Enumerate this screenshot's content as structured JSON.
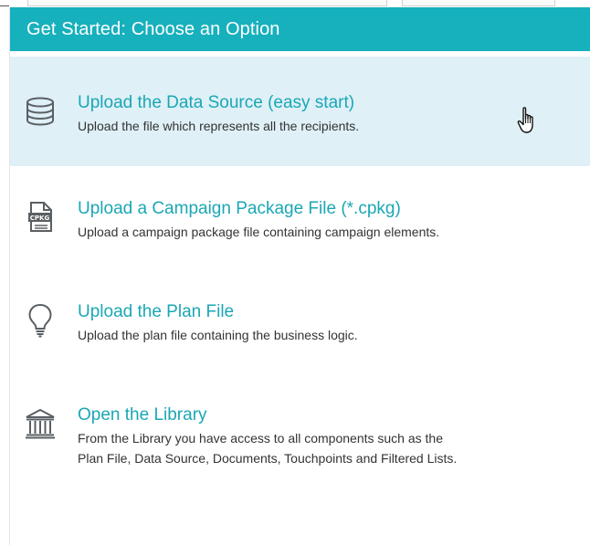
{
  "panel": {
    "title": "Get Started: Choose an Option"
  },
  "options": [
    {
      "title": "Upload the Data Source (easy start)",
      "description": "Upload the file which represents all the recipients.",
      "icon": "database-icon",
      "highlighted": true
    },
    {
      "title": "Upload a Campaign Package File (*.cpkg)",
      "description": "Upload a campaign package file containing campaign elements.",
      "icon": "cpkg-file-icon",
      "icon_label": "CPKG",
      "highlighted": false
    },
    {
      "title": "Upload the Plan File",
      "description": "Upload the plan file containing the business logic.",
      "icon": "lightbulb-icon",
      "highlighted": false
    },
    {
      "title": "Open the Library",
      "description_line1": "From the Library you have access to all components such as the",
      "description_line2": "Plan File, Data Source, Documents, Touchpoints and Filtered Lists.",
      "icon": "library-icon",
      "highlighted": false
    }
  ],
  "colors": {
    "header_bg": "#17b0bd",
    "title_text": "#1aa7b5",
    "highlight_bg": "#dff0f7",
    "icon_stroke": "#5a5f63"
  }
}
